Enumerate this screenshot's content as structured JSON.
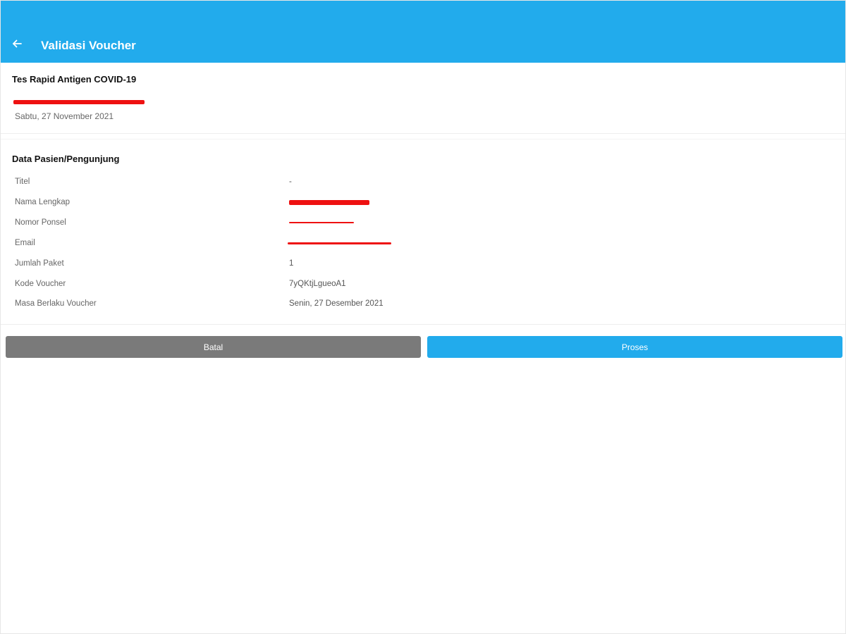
{
  "header": {
    "title": "Validasi Voucher",
    "back_icon": "arrow-left-icon",
    "color": "#22abec"
  },
  "service": {
    "name": "Tes Rapid Antigen COVID-19",
    "date": "Sabtu, 27 November 2021"
  },
  "patient": {
    "section_title": "Data Pasien/Pengunjung",
    "fields": [
      {
        "label": "Titel",
        "value": "-"
      },
      {
        "label": "Nama Lengkap",
        "value": ""
      },
      {
        "label": "Nomor Ponsel",
        "value": ""
      },
      {
        "label": "Email",
        "value": ""
      },
      {
        "label": "Jumlah Paket",
        "value": "1"
      },
      {
        "label": "Kode Voucher",
        "value": "7yQKtjLgueoA1"
      },
      {
        "label": "Masa Berlaku Voucher",
        "value": "Senin, 27 Desember 2021"
      }
    ]
  },
  "actions": {
    "cancel_label": "Batal",
    "process_label": "Proses",
    "cancel_color": "#7a7a7a",
    "process_color": "#22abec"
  },
  "redaction_color": "#ee1111"
}
